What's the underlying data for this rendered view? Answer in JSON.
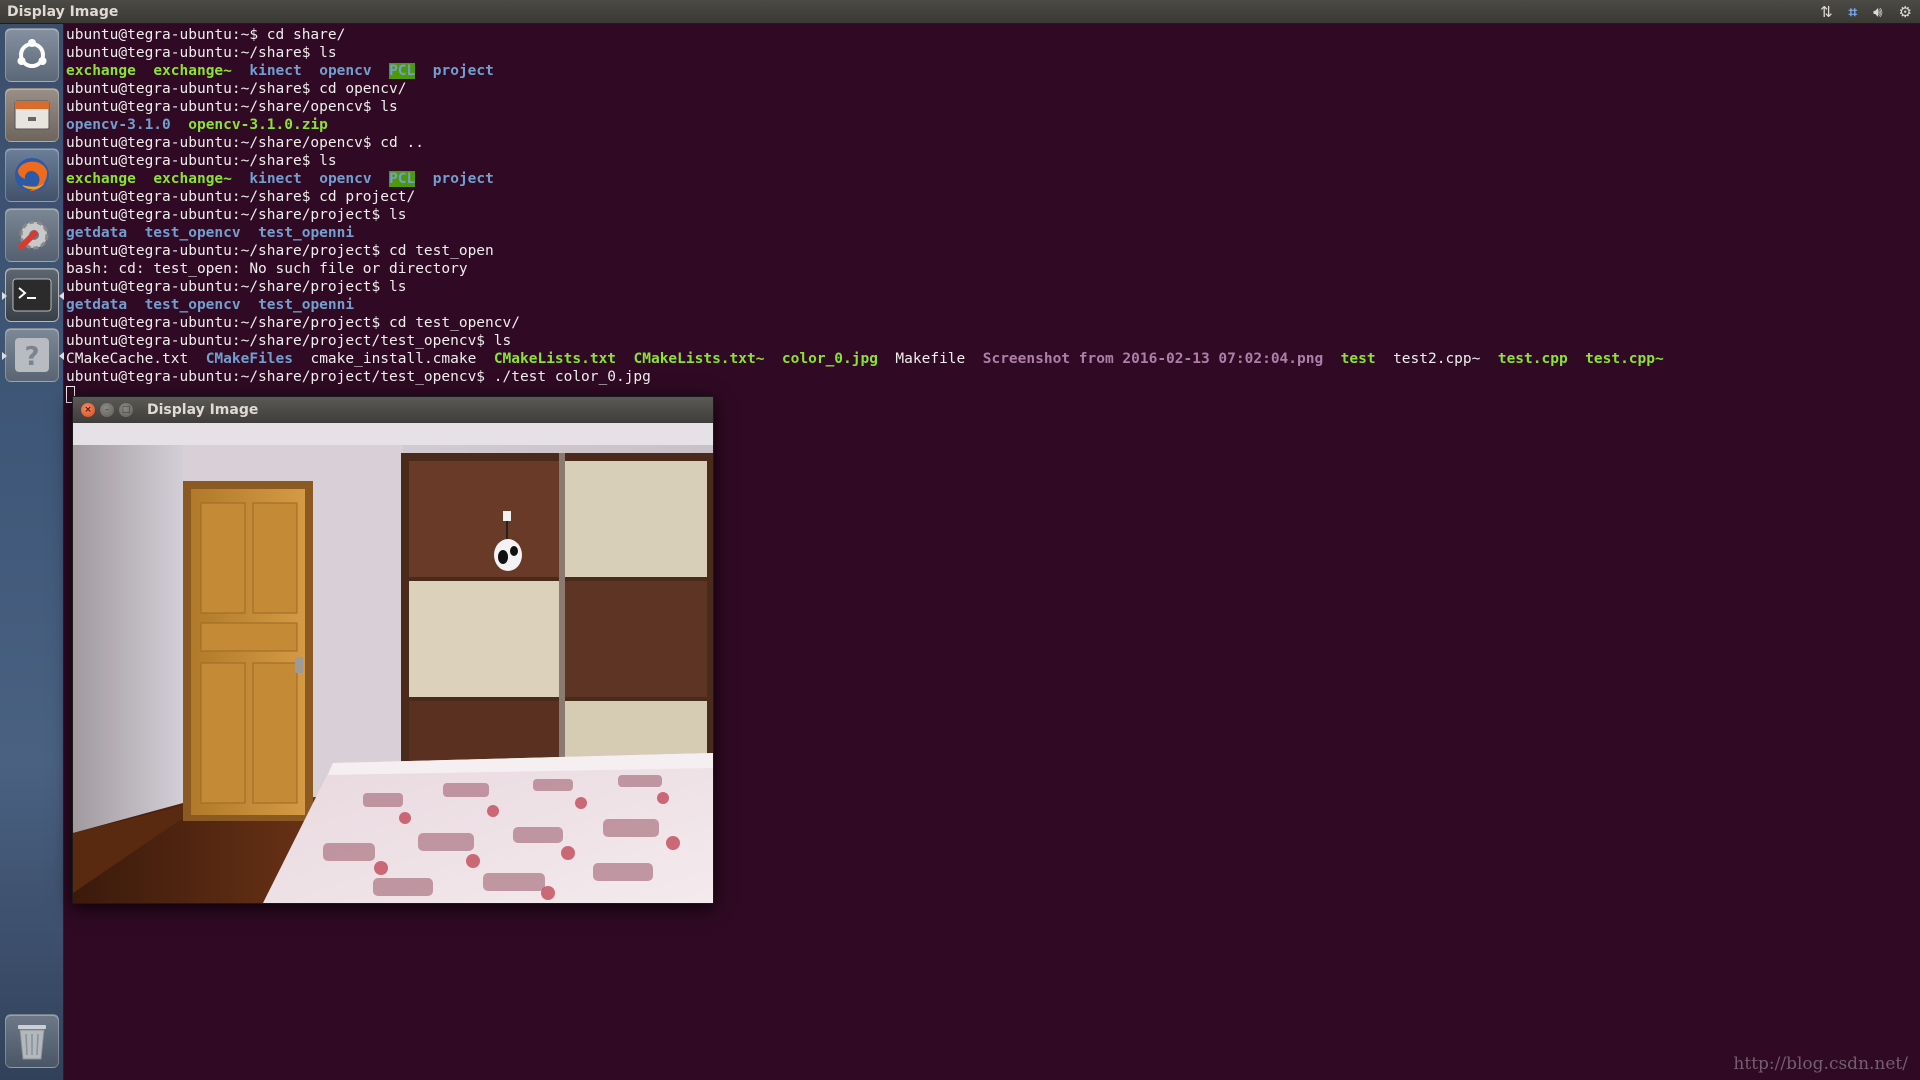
{
  "top_panel": {
    "title": "Display Image",
    "indicators": [
      "network-icon",
      "keyboard-layout-icon",
      "volume-icon",
      "settings-gear-icon"
    ]
  },
  "launcher": {
    "items": [
      "ubuntu-dash-icon",
      "files-icon",
      "firefox-icon",
      "system-settings-icon",
      "terminal-icon",
      "help-icon"
    ],
    "trash": "trash-icon"
  },
  "terminal": {
    "lines": [
      [
        {
          "t": "ubuntu@tegra-ubuntu:~$ cd share/",
          "c": "plain"
        }
      ],
      [
        {
          "t": "ubuntu@tegra-ubuntu:~/share$ ls",
          "c": "plain"
        }
      ],
      [
        {
          "t": "exchange",
          "c": "exec"
        },
        {
          "t": "  ",
          "c": "plain"
        },
        {
          "t": "exchange~",
          "c": "exec"
        },
        {
          "t": "  ",
          "c": "plain"
        },
        {
          "t": "kinect",
          "c": "dir"
        },
        {
          "t": "  ",
          "c": "plain"
        },
        {
          "t": "opencv",
          "c": "dir"
        },
        {
          "t": "  ",
          "c": "plain"
        },
        {
          "t": "PCL",
          "c": "dir-hl"
        },
        {
          "t": "  ",
          "c": "plain"
        },
        {
          "t": "project",
          "c": "dir"
        }
      ],
      [
        {
          "t": "ubuntu@tegra-ubuntu:~/share$ cd opencv/",
          "c": "plain"
        }
      ],
      [
        {
          "t": "ubuntu@tegra-ubuntu:~/share/opencv$ ls",
          "c": "plain"
        }
      ],
      [
        {
          "t": "opencv-3.1.0",
          "c": "dir"
        },
        {
          "t": "  ",
          "c": "plain"
        },
        {
          "t": "opencv-3.1.0.zip",
          "c": "exec"
        }
      ],
      [
        {
          "t": "ubuntu@tegra-ubuntu:~/share/opencv$ cd ..",
          "c": "plain"
        }
      ],
      [
        {
          "t": "ubuntu@tegra-ubuntu:~/share$ ls",
          "c": "plain"
        }
      ],
      [
        {
          "t": "exchange",
          "c": "exec"
        },
        {
          "t": "  ",
          "c": "plain"
        },
        {
          "t": "exchange~",
          "c": "exec"
        },
        {
          "t": "  ",
          "c": "plain"
        },
        {
          "t": "kinect",
          "c": "dir"
        },
        {
          "t": "  ",
          "c": "plain"
        },
        {
          "t": "opencv",
          "c": "dir"
        },
        {
          "t": "  ",
          "c": "plain"
        },
        {
          "t": "PCL",
          "c": "dir-hl"
        },
        {
          "t": "  ",
          "c": "plain"
        },
        {
          "t": "project",
          "c": "dir"
        }
      ],
      [
        {
          "t": "ubuntu@tegra-ubuntu:~/share$ cd project/",
          "c": "plain"
        }
      ],
      [
        {
          "t": "ubuntu@tegra-ubuntu:~/share/project$ ls",
          "c": "plain"
        }
      ],
      [
        {
          "t": "getdata",
          "c": "dir"
        },
        {
          "t": "  ",
          "c": "plain"
        },
        {
          "t": "test_opencv",
          "c": "dir"
        },
        {
          "t": "  ",
          "c": "plain"
        },
        {
          "t": "test_openni",
          "c": "dir"
        }
      ],
      [
        {
          "t": "ubuntu@tegra-ubuntu:~/share/project$ cd test_open",
          "c": "plain"
        }
      ],
      [
        {
          "t": "bash: cd: test_open: No such file or directory",
          "c": "plain"
        }
      ],
      [
        {
          "t": "ubuntu@tegra-ubuntu:~/share/project$ ls",
          "c": "plain"
        }
      ],
      [
        {
          "t": "getdata",
          "c": "dir"
        },
        {
          "t": "  ",
          "c": "plain"
        },
        {
          "t": "test_opencv",
          "c": "dir"
        },
        {
          "t": "  ",
          "c": "plain"
        },
        {
          "t": "test_openni",
          "c": "dir"
        }
      ],
      [
        {
          "t": "ubuntu@tegra-ubuntu:~/share/project$ cd test_opencv/",
          "c": "plain"
        }
      ],
      [
        {
          "t": "ubuntu@tegra-ubuntu:~/share/project/test_opencv$ ls",
          "c": "plain"
        }
      ],
      [
        {
          "t": "CMakeCache.txt",
          "c": "plain"
        },
        {
          "t": "  ",
          "c": "plain"
        },
        {
          "t": "CMakeFiles",
          "c": "dir"
        },
        {
          "t": "  ",
          "c": "plain"
        },
        {
          "t": "cmake_install.cmake",
          "c": "plain"
        },
        {
          "t": "  ",
          "c": "plain"
        },
        {
          "t": "CMakeLists.txt",
          "c": "exec"
        },
        {
          "t": "  ",
          "c": "plain"
        },
        {
          "t": "CMakeLists.txt~",
          "c": "exec"
        },
        {
          "t": "  ",
          "c": "plain"
        },
        {
          "t": "color_0.jpg",
          "c": "exec"
        },
        {
          "t": "  ",
          "c": "plain"
        },
        {
          "t": "Makefile",
          "c": "plain"
        },
        {
          "t": "  ",
          "c": "plain"
        },
        {
          "t": "Screenshot from 2016-02-13 07:02:04.png",
          "c": "img"
        },
        {
          "t": "  ",
          "c": "plain"
        },
        {
          "t": "test",
          "c": "exec"
        },
        {
          "t": "  ",
          "c": "plain"
        },
        {
          "t": "test2.cpp~",
          "c": "plain"
        },
        {
          "t": "  ",
          "c": "plain"
        },
        {
          "t": "test.cpp",
          "c": "exec"
        },
        {
          "t": "  ",
          "c": "plain"
        },
        {
          "t": "test.cpp~",
          "c": "exec"
        }
      ],
      [
        {
          "t": "ubuntu@tegra-ubuntu:~/share/project/test_opencv$ ./test color_0.jpg",
          "c": "plain"
        }
      ]
    ]
  },
  "image_window": {
    "title": "Display Image",
    "close_glyph": "×",
    "minimize_glyph": "–",
    "maximize_glyph": "□"
  },
  "watermark": "http://blog.csdn.net/",
  "colors": {
    "terminal_bg": "#300a24",
    "exec_green": "#8ae234",
    "dir_blue": "#729fcf",
    "image_magenta": "#ad7fa8",
    "highlight_green": "#4e9a06"
  }
}
